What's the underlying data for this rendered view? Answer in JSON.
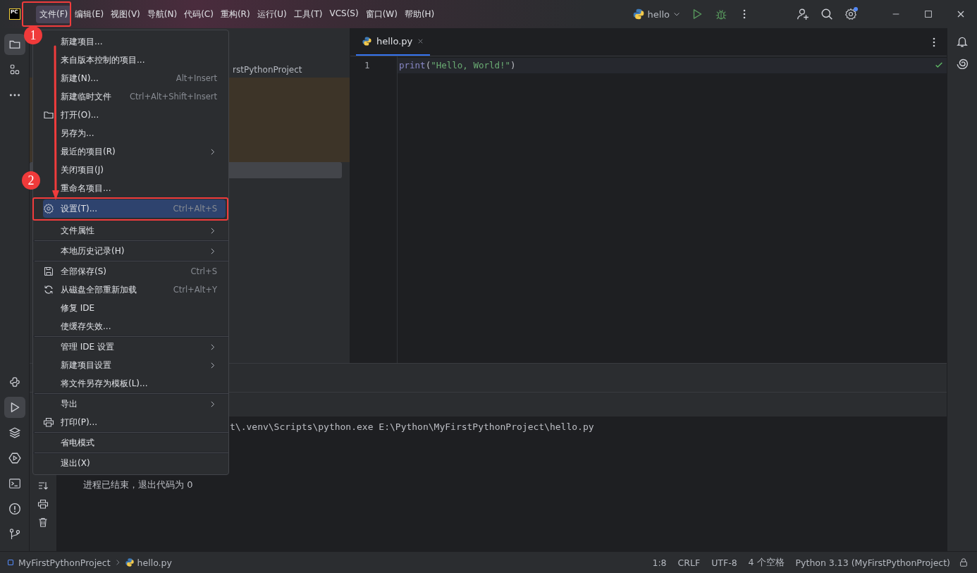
{
  "title_bar": {
    "logo_text": "PC",
    "menus": [
      {
        "label": "文件(F)",
        "selected": true
      },
      {
        "label": "编辑(E)",
        "selected": false
      },
      {
        "label": "视图(V)",
        "selected": false
      },
      {
        "label": "导航(N)",
        "selected": false
      },
      {
        "label": "代码(C)",
        "selected": false
      },
      {
        "label": "重构(R)",
        "selected": false
      },
      {
        "label": "运行(U)",
        "selected": false
      },
      {
        "label": "工具(T)",
        "selected": false
      },
      {
        "label": "VCS(S)",
        "selected": false
      },
      {
        "label": "窗口(W)",
        "selected": false
      },
      {
        "label": "帮助(H)",
        "selected": false
      }
    ],
    "run_config": "hello"
  },
  "left_tools": {
    "top": [
      {
        "selected": true
      },
      {
        "selected": false
      },
      {
        "selected": false
      }
    ],
    "bottom": [
      {
        "selected": false
      },
      {
        "selected": true
      },
      {
        "selected": false
      },
      {
        "selected": false
      },
      {
        "selected": false
      },
      {
        "selected": false
      },
      {
        "selected": false
      }
    ]
  },
  "project_panel": {
    "root_label": "rstPythonProject"
  },
  "editor": {
    "tabs": [
      {
        "label": "hello.py",
        "selected": true
      }
    ],
    "lines": [
      {
        "number": "1",
        "tokens": [
          {
            "text": "print",
            "kind": "builtin"
          },
          {
            "text": "(",
            "kind": "punct"
          },
          {
            "text": "\"Hello, World!\"",
            "kind": "string"
          },
          {
            "text": ")",
            "kind": "punct"
          }
        ]
      }
    ]
  },
  "run_panel": {
    "console": [
      "t\\.venv\\Scripts\\python.exe E:\\Python\\MyFirstPythonProject\\hello.py",
      "进程已结束，退出代码为 0"
    ]
  },
  "file_menu": [
    {
      "kind": "item",
      "label": "新建项目...",
      "selected": false
    },
    {
      "kind": "item",
      "label": "来自版本控制的项目...",
      "selected": false
    },
    {
      "kind": "item",
      "label": "新建(N)...",
      "shortcut": "Alt+Insert",
      "selected": false
    },
    {
      "kind": "item",
      "label": "新建临时文件",
      "shortcut": "Ctrl+Alt+Shift+Insert",
      "selected": false
    },
    {
      "kind": "item",
      "label": "打开(O)...",
      "selected": false
    },
    {
      "kind": "item",
      "label": "另存为...",
      "selected": false
    },
    {
      "kind": "item",
      "label": "最近的项目(R)",
      "submenu": true,
      "selected": false
    },
    {
      "kind": "item",
      "label": "关闭项目(J)",
      "selected": false
    },
    {
      "kind": "item",
      "label": "重命名项目...",
      "selected": false
    },
    {
      "kind": "gap"
    },
    {
      "kind": "item",
      "label": "设置(T)...",
      "shortcut": "Ctrl+Alt+S",
      "selected": true
    },
    {
      "kind": "item",
      "label": "文件属性",
      "submenu": true,
      "selected": false
    },
    {
      "kind": "separator"
    },
    {
      "kind": "item",
      "label": "本地历史记录(H)",
      "submenu": true,
      "selected": false
    },
    {
      "kind": "separator"
    },
    {
      "kind": "item",
      "label": "全部保存(S)",
      "shortcut": "Ctrl+S",
      "selected": false
    },
    {
      "kind": "item",
      "label": "从磁盘全部重新加载",
      "shortcut": "Ctrl+Alt+Y",
      "selected": false
    },
    {
      "kind": "item",
      "label": "修复 IDE",
      "selected": false
    },
    {
      "kind": "item",
      "label": "使缓存失效...",
      "selected": false
    },
    {
      "kind": "separator"
    },
    {
      "kind": "item",
      "label": "管理 IDE 设置",
      "submenu": true,
      "selected": false
    },
    {
      "kind": "item",
      "label": "新建项目设置",
      "submenu": true,
      "selected": false
    },
    {
      "kind": "item",
      "label": "将文件另存为模板(L)...",
      "selected": false
    },
    {
      "kind": "separator"
    },
    {
      "kind": "item",
      "label": "导出",
      "submenu": true,
      "selected": false
    },
    {
      "kind": "item",
      "label": "打印(P)...",
      "selected": false
    },
    {
      "kind": "separator"
    },
    {
      "kind": "item",
      "label": "省电模式",
      "selected": false
    },
    {
      "kind": "separator"
    },
    {
      "kind": "item",
      "label": "退出(X)",
      "selected": false
    }
  ],
  "annotations": [
    {
      "text": "1"
    },
    {
      "text": "2"
    }
  ],
  "status_bar": {
    "breadcrumbs": [
      "MyFirstPythonProject",
      "hello.py"
    ],
    "items": [
      "1:8",
      "CRLF",
      "UTF-8",
      "4 个空格",
      "Python 3.13 (MyFirstPythonProject)"
    ]
  }
}
